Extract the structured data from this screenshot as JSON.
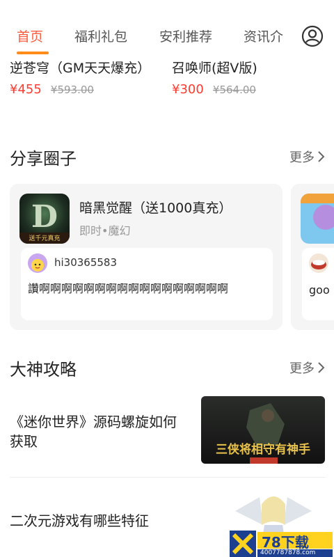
{
  "tabs": [
    {
      "label": "首页",
      "active": true
    },
    {
      "label": "福利礼包",
      "active": false
    },
    {
      "label": "安利推荐",
      "active": false
    },
    {
      "label": "资讯介",
      "active": false
    }
  ],
  "top_games": [
    {
      "name": "逆苍穹（GM天天爆充）",
      "price": "¥455",
      "original_price": "¥593.00"
    },
    {
      "name": "召唤师(超V版)",
      "price": "¥300",
      "original_price": "¥564.00"
    }
  ],
  "share_section": {
    "title": "分享圈子",
    "more": "更多"
  },
  "share_cards": [
    {
      "game_title": "暗黑觉醒（送1000真充）",
      "tags": "即时•魔幻",
      "icon_text": "送千元真充",
      "username": "hi30365583",
      "post_text": "讚啊啊啊啊啊啊啊啊啊啊啊啊啊啊啊啊啊"
    },
    {
      "username": "goo"
    }
  ],
  "guide_section": {
    "title": "大神攻略",
    "more": "更多"
  },
  "guides": [
    {
      "title": "《迷你世界》源码螺旋如何获取",
      "image_caption": "三侠将相守有神手"
    },
    {
      "title": "二次元游戏有哪些特征"
    }
  ],
  "watermark": {
    "brand": "78下载",
    "url": "4007787878.com"
  },
  "colors": {
    "accent": "#ff5a3c",
    "underline": "#ff8c1a",
    "price": "#ff3b30"
  }
}
